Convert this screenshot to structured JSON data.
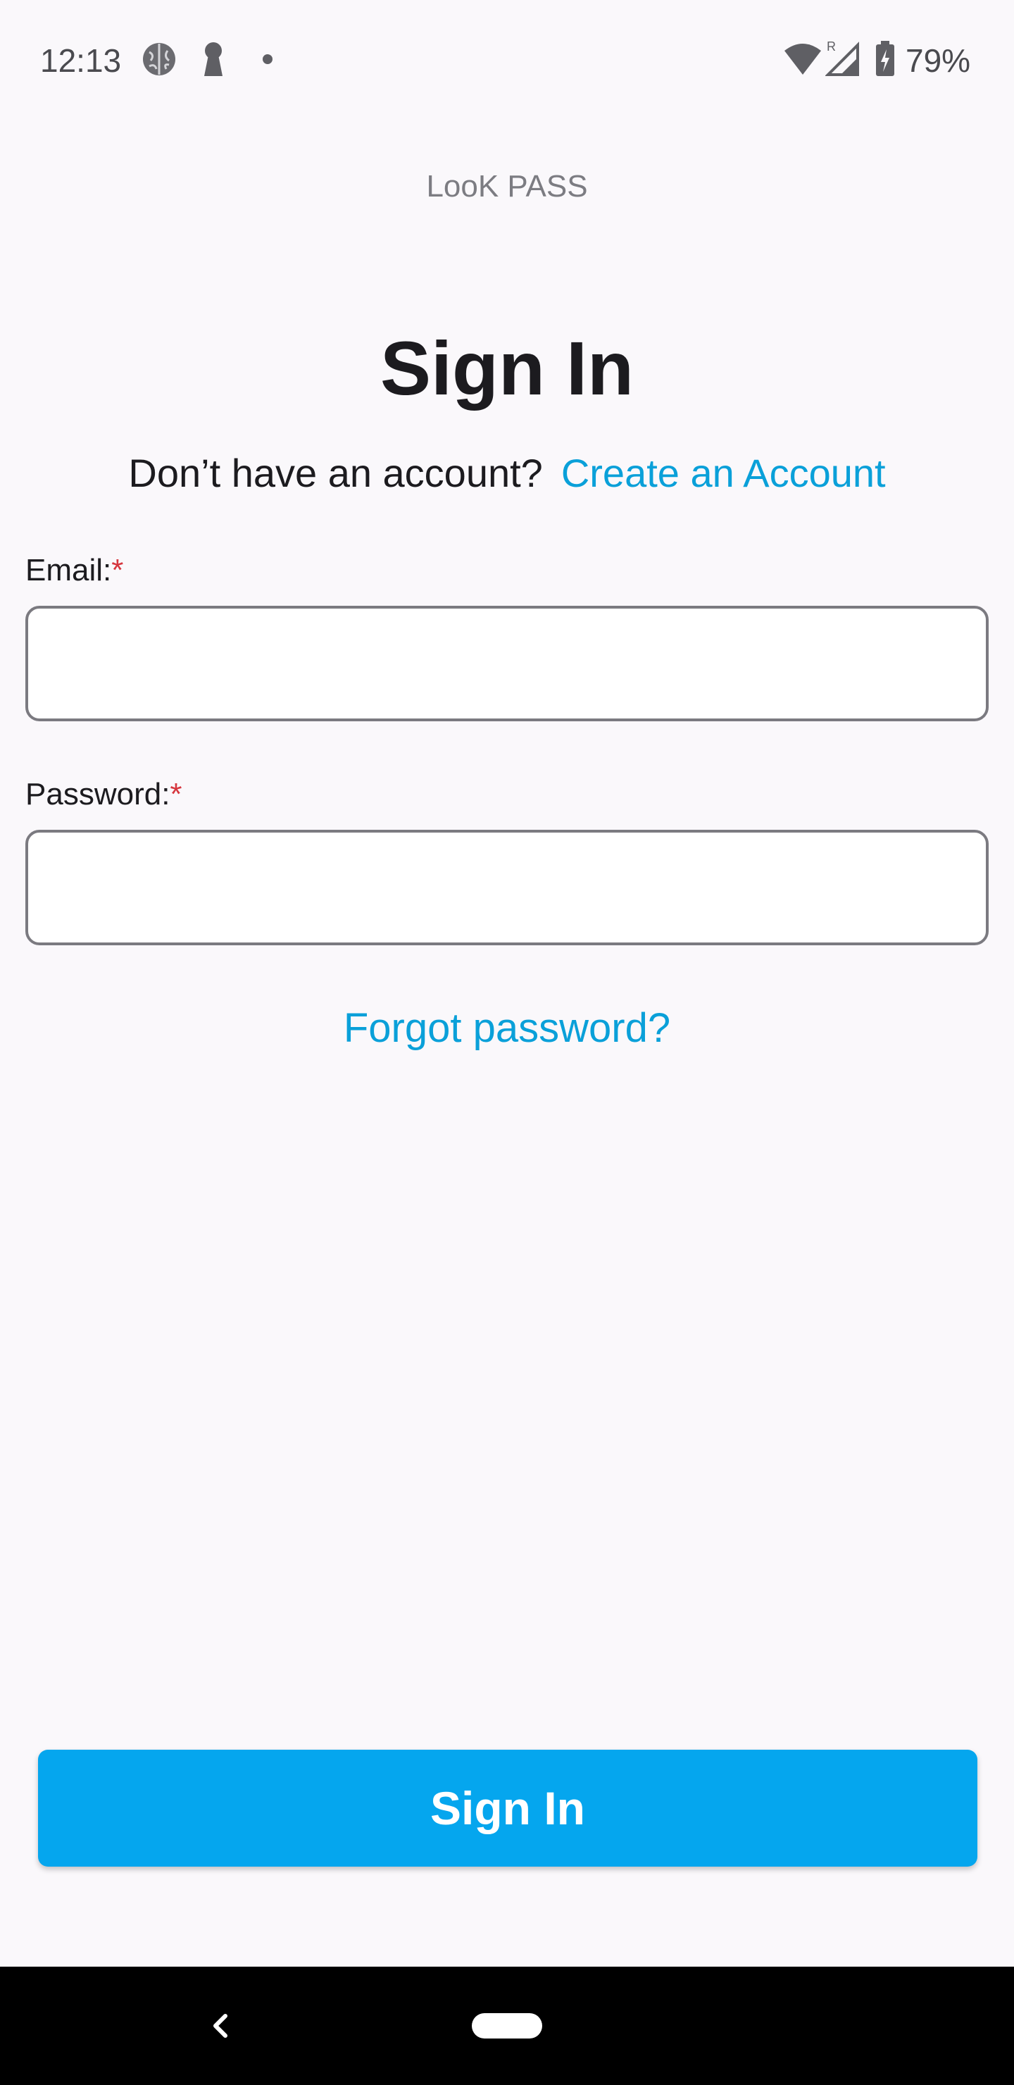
{
  "status_bar": {
    "time": "12:13",
    "battery": "79%",
    "icons": [
      "brain-icon",
      "keyhole-icon",
      "dot-icon",
      "wifi-icon",
      "signal-roaming-icon",
      "battery-charging-icon"
    ]
  },
  "app": {
    "title": "LooK PASS"
  },
  "page": {
    "title": "Sign In",
    "signup_prompt": "Don’t have an account?",
    "signup_link": "Create an Account"
  },
  "form": {
    "email_label": "Email:",
    "password_label": "Password:",
    "required_mark": "*",
    "email_value": "",
    "password_value": "",
    "forgot_password": "Forgot password?",
    "submit_label": "Sign In"
  },
  "colors": {
    "accent": "#05a6ee",
    "link": "#0aa0d9",
    "required": "#d6363e",
    "background": "#faf8fb"
  }
}
